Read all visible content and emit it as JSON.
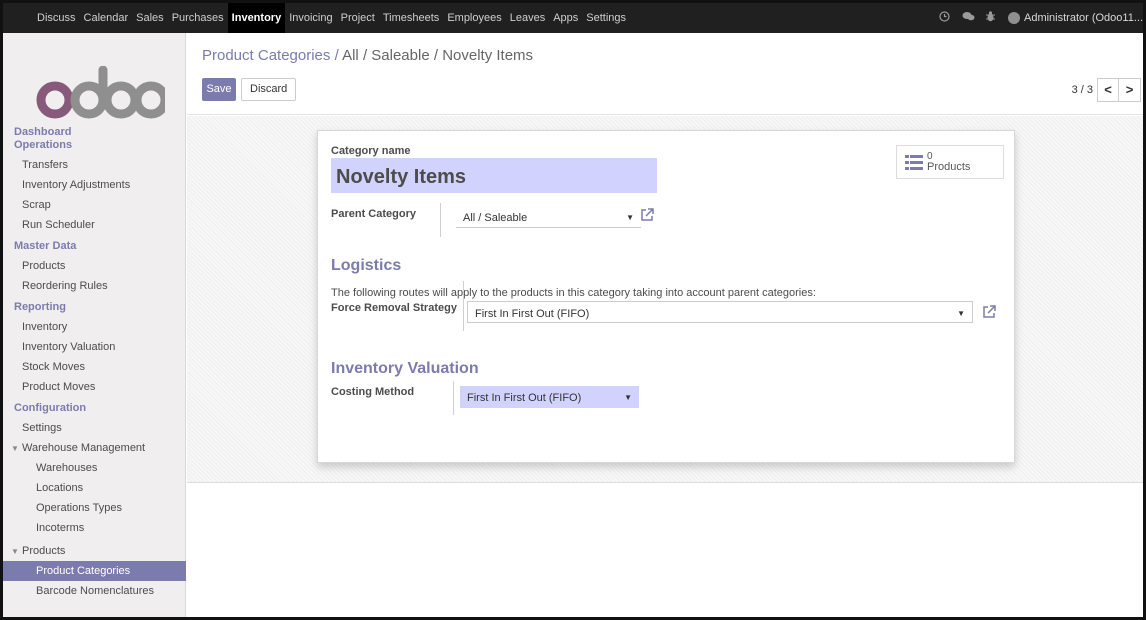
{
  "topbar": {
    "menu": [
      "Discuss",
      "Calendar",
      "Sales",
      "Purchases",
      "Inventory",
      "Invoicing",
      "Project",
      "Timesheets",
      "Employees",
      "Leaves",
      "Apps",
      "Settings"
    ],
    "active": "Inventory",
    "user": "Administrator (Odoo11..."
  },
  "logo": {
    "text": "odoo",
    "color": "#875a7b"
  },
  "sidebar": {
    "dashboard": "Dashboard",
    "operations": "Operations",
    "transfers": "Transfers",
    "inventory_adjustments": "Inventory Adjustments",
    "scrap": "Scrap",
    "run_scheduler": "Run Scheduler",
    "master_data": "Master Data",
    "products": "Products",
    "reordering_rules": "Reordering Rules",
    "reporting": "Reporting",
    "inventory": "Inventory",
    "inventory_valuation": "Inventory Valuation",
    "stock_moves": "Stock Moves",
    "product_moves": "Product Moves",
    "configuration": "Configuration",
    "settings": "Settings",
    "warehouse_management": "Warehouse Management",
    "warehouses": "Warehouses",
    "locations": "Locations",
    "operations_types": "Operations Types",
    "incoterms": "Incoterms",
    "products_group": "Products",
    "product_categories": "Product Categories",
    "barcode_nomenclatures": "Barcode Nomenclatures"
  },
  "breadcrumb": {
    "root": "Product Categories",
    "sep1": "/",
    "all": "All",
    "sep2": "/",
    "saleable": "Saleable",
    "sep3": "/",
    "current": "Novelty Items"
  },
  "buttons": {
    "save": "Save",
    "discard": "Discard"
  },
  "pager": {
    "value": "3 / 3",
    "prev": "<",
    "next": ">"
  },
  "form": {
    "category_name_label": "Category name",
    "category_name": "Novelty Items",
    "smart_count": "0",
    "smart_label": "Products",
    "parent_label": "Parent Category",
    "parent_value": "All / Saleable",
    "logistics_title": "Logistics",
    "logistics_note": "The following routes will apply to the products in this category taking into account parent categories:",
    "removal_label": "Force Removal Strategy",
    "removal_value": "First In First Out (FIFO)",
    "valuation_title": "Inventory Valuation",
    "costing_label": "Costing Method",
    "costing_value": "First In First Out (FIFO)"
  },
  "colors": {
    "accent": "#7c7bad",
    "highlight": "#d2d2ff",
    "topbar": "#202020"
  }
}
